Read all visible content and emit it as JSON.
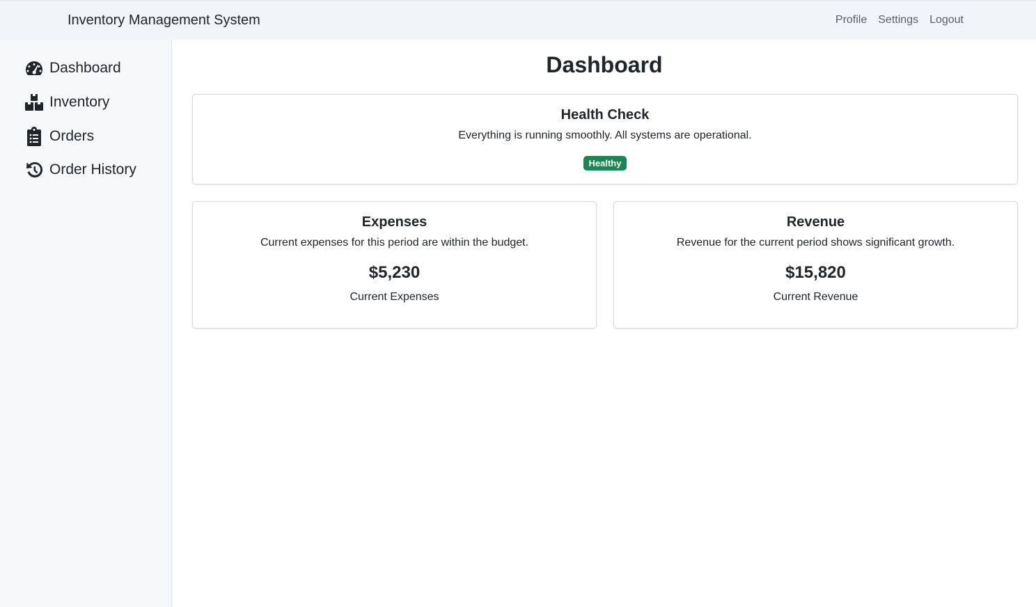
{
  "navbar": {
    "brand": "Inventory Management System",
    "links": [
      "Profile",
      "Settings",
      "Logout"
    ]
  },
  "sidebar": {
    "items": [
      {
        "label": "Dashboard",
        "icon": "gauge-icon"
      },
      {
        "label": "Inventory",
        "icon": "boxes-icon"
      },
      {
        "label": "Orders",
        "icon": "clipboard-list-icon"
      },
      {
        "label": "Order History",
        "icon": "history-icon"
      }
    ]
  },
  "main": {
    "title": "Dashboard",
    "health": {
      "title": "Health Check",
      "text": "Everything is running smoothly. All systems are operational.",
      "badge": "Healthy",
      "badge_color": "#198754"
    },
    "expenses": {
      "title": "Expenses",
      "text": "Current expenses for this period are within the budget.",
      "amount": "$5,230",
      "label": "Current Expenses"
    },
    "revenue": {
      "title": "Revenue",
      "text": "Revenue for the current period shows significant growth.",
      "amount": "$15,820",
      "label": "Current Revenue"
    }
  }
}
